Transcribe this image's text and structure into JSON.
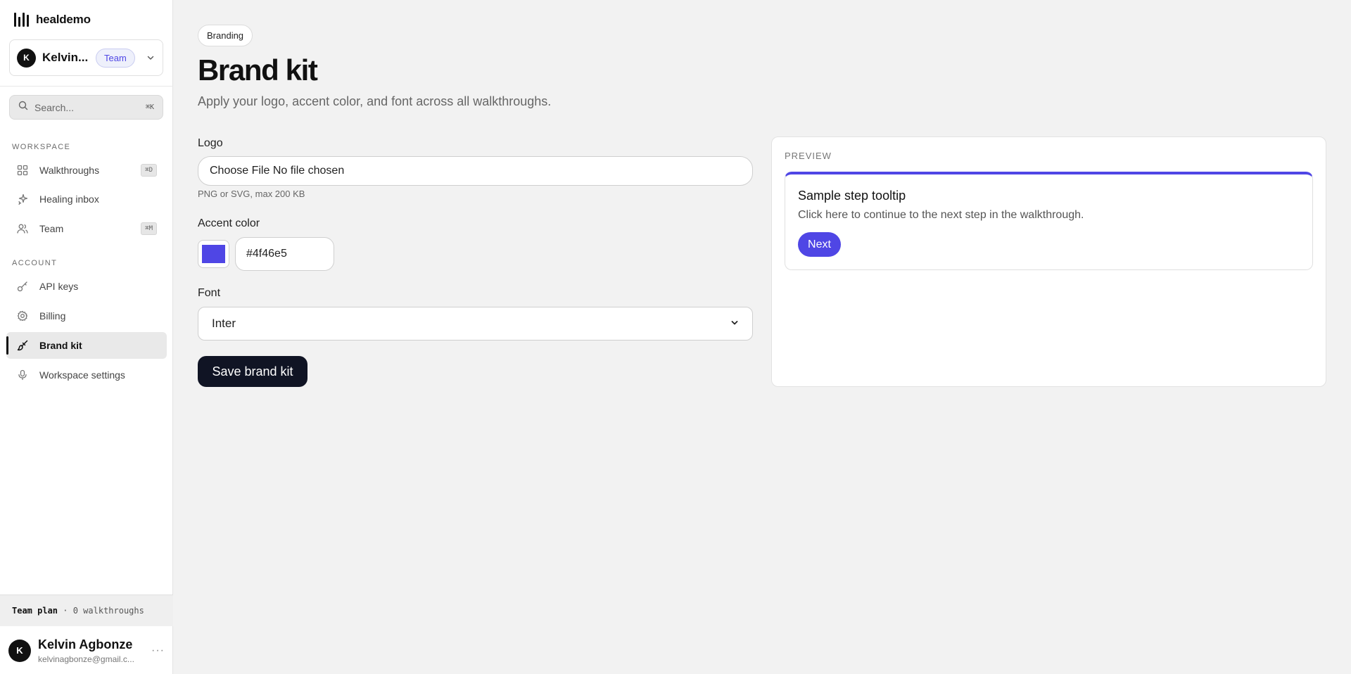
{
  "app": {
    "name": "healdemo"
  },
  "workspace": {
    "avatar_initial": "K",
    "name": "Kelvin...",
    "plan_badge": "Team"
  },
  "search": {
    "placeholder": "Search...",
    "shortcut": "⌘K"
  },
  "sidebar": {
    "workspace_section": "WORKSPACE",
    "account_section": "ACCOUNT",
    "workspace_items": [
      {
        "label": "Walkthroughs",
        "shortcut": "⌘D",
        "icon": "grid-icon"
      },
      {
        "label": "Healing inbox",
        "shortcut": "",
        "icon": "sparkle-icon"
      },
      {
        "label": "Team",
        "shortcut": "⌘M",
        "icon": "users-icon"
      }
    ],
    "account_items": [
      {
        "label": "API keys",
        "icon": "key-icon"
      },
      {
        "label": "Billing",
        "icon": "gear-icon"
      },
      {
        "label": "Brand kit",
        "icon": "paintbrush-icon",
        "active": true
      },
      {
        "label": "Workspace settings",
        "icon": "mic-icon"
      }
    ],
    "plan": {
      "name": "Team plan",
      "detail": "· 0 walkthroughs"
    },
    "user": {
      "initial": "K",
      "name": "Kelvin Agbonze",
      "email": "kelvinagbonze@gmail.c..."
    }
  },
  "main": {
    "breadcrumb": "Branding",
    "title": "Brand kit",
    "subtitle": "Apply your logo, accent color, and font across all walkthroughs.",
    "logo_label": "Logo",
    "logo_input_value": "Choose File No file chosen",
    "logo_hint": "PNG or SVG, max 200 KB",
    "accent_label": "Accent color",
    "accent_value": "#4f46e5",
    "font_label": "Font",
    "font_value": "Inter",
    "save_label": "Save brand kit"
  },
  "preview": {
    "label": "PREVIEW",
    "tooltip_title": "Sample step tooltip",
    "tooltip_text": "Click here to continue to the next step in the walkthrough.",
    "next_label": "Next"
  },
  "colors": {
    "accent": "#4f46e5",
    "dark_button": "#101424"
  }
}
